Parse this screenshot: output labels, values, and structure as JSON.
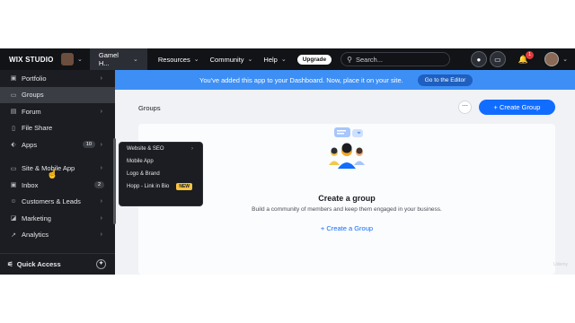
{
  "topbar": {
    "logo": "WIX STUDIO",
    "site_name": "Gamel H...",
    "menu": [
      "Resources",
      "Community",
      "Help"
    ],
    "upgrade": "Upgrade",
    "search_placeholder": "Search...",
    "notification_count": "1"
  },
  "banner": {
    "message": "You've added this app to your Dashboard. Now, place it on your site.",
    "button": "Go to the Editor"
  },
  "sidebar": {
    "items": [
      {
        "label": "Portfolio",
        "icon": "portfolio-icon",
        "arrow": true
      },
      {
        "label": "Groups",
        "icon": "groups-icon",
        "active": true
      },
      {
        "label": "Forum",
        "icon": "forum-icon",
        "arrow": true
      },
      {
        "label": "File Share",
        "icon": "file-icon"
      },
      {
        "label": "Apps",
        "icon": "apps-icon",
        "count": "10",
        "arrow": true
      },
      {
        "label": "Site & Mobile App",
        "icon": "site-icon",
        "arrow": true
      },
      {
        "label": "Inbox",
        "icon": "inbox-icon",
        "count": "2"
      },
      {
        "label": "Customers & Leads",
        "icon": "customers-icon",
        "arrow": true
      },
      {
        "label": "Marketing",
        "icon": "marketing-icon",
        "arrow": true
      },
      {
        "label": "Analytics",
        "icon": "analytics-icon",
        "arrow": true
      }
    ],
    "quick_access": "Quick Access"
  },
  "dropdown": {
    "items": [
      {
        "label": "Website & SEO",
        "arrow": true
      },
      {
        "label": "Mobile App"
      },
      {
        "label": "Logo & Brand"
      },
      {
        "label": "Hopp - Link in Bio",
        "badge": "NEW"
      }
    ]
  },
  "content": {
    "title": "Groups",
    "create_button": "+ Create Group",
    "card_title": "Create a group",
    "card_subtitle": "Build a community of members and keep them engaged in your business.",
    "card_link": "+ Create a Group"
  },
  "watermark": "Udemy",
  "colors": {
    "accent": "#116dff",
    "banner": "#3d8ff5",
    "sidebar": "#1b1d22",
    "topbar": "#111316"
  }
}
